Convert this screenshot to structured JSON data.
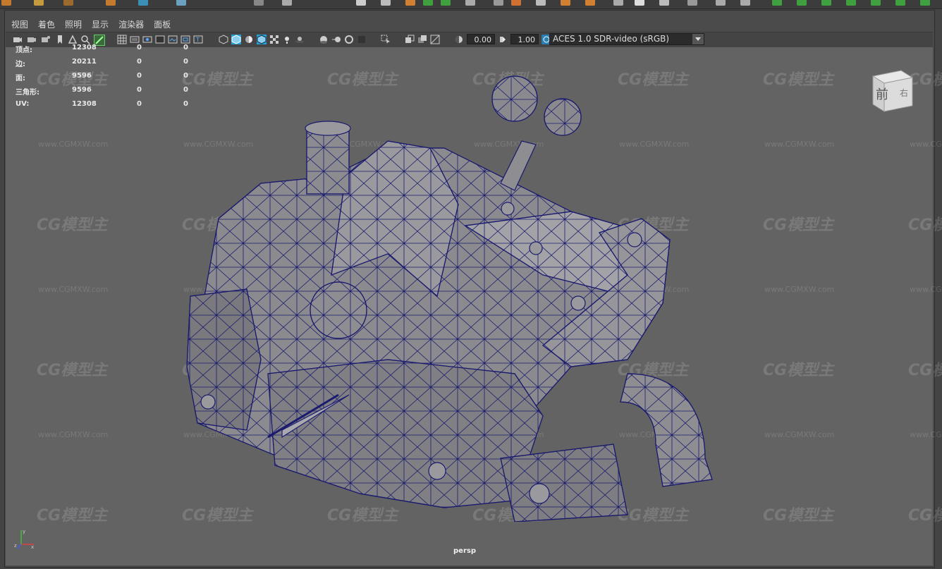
{
  "menubar": {
    "items": [
      "视图",
      "着色",
      "照明",
      "显示",
      "渲染器",
      "面板"
    ]
  },
  "toolbar": {
    "exposure_value": "0.00",
    "gamma_value": "1.00",
    "color_space": "ACES 1.0 SDR-video (sRGB)",
    "top_shelf_value": "0.00"
  },
  "hud": {
    "rows": [
      {
        "label": "顶点:",
        "total": "12308",
        "selected": "0",
        "selected_components": "0"
      },
      {
        "label": "边:",
        "total": "20211",
        "selected": "0",
        "selected_components": "0"
      },
      {
        "label": "面:",
        "total": "9596",
        "selected": "0",
        "selected_components": "0"
      },
      {
        "label": "三角形:",
        "total": "9596",
        "selected": "0",
        "selected_components": "0"
      },
      {
        "label": "UV:",
        "total": "12308",
        "selected": "0",
        "selected_components": "0"
      }
    ]
  },
  "viewport": {
    "camera_label": "persp",
    "viewcube_face": "前",
    "viewcube_side": "右"
  },
  "watermark": {
    "logo": "CG模型主",
    "url": "www.CGMXW.com"
  },
  "colors": {
    "viewport_bg": "#636363",
    "wireframe": "#1a1a6e",
    "accent": "#2a9fd6"
  }
}
